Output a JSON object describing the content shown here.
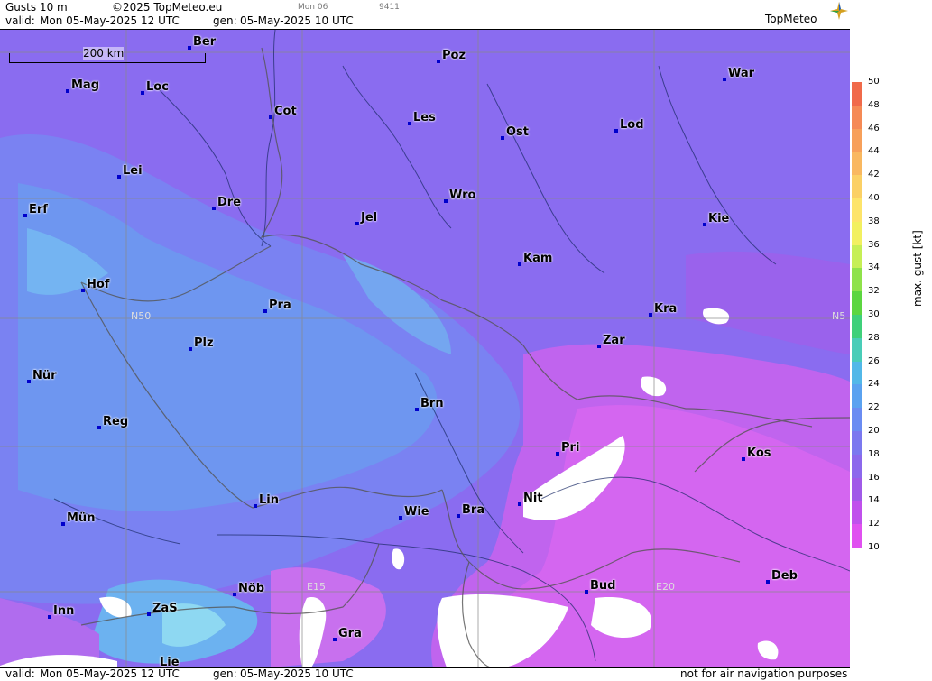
{
  "header": {
    "title": "Gusts 10 m",
    "copyright": "©2025 TopMeteo.eu",
    "day_small": "Mon 06",
    "code_small": "9411",
    "valid_label": "valid:",
    "valid": "Mon  05-May-2025  12 UTC",
    "gen_label": "gen:",
    "gen": "05-May-2025 10 UTC",
    "logo": "TopMeteo"
  },
  "scale_bar": "200 km",
  "grid_labels": {
    "n50_left": "N50",
    "n50_right": "N5",
    "e15": "E15",
    "e20": "E20"
  },
  "cities": [
    {
      "name": "Ber"
    },
    {
      "name": "Poz"
    },
    {
      "name": "War"
    },
    {
      "name": "Mag"
    },
    {
      "name": "Loc"
    },
    {
      "name": "Cot"
    },
    {
      "name": "Les"
    },
    {
      "name": "Ost"
    },
    {
      "name": "Lod"
    },
    {
      "name": "Lei"
    },
    {
      "name": "Erf"
    },
    {
      "name": "Dre"
    },
    {
      "name": "Wro"
    },
    {
      "name": "Jel"
    },
    {
      "name": "Kie"
    },
    {
      "name": "Kam"
    },
    {
      "name": "Hof"
    },
    {
      "name": "Pra"
    },
    {
      "name": "Kra"
    },
    {
      "name": "Plz"
    },
    {
      "name": "Zar"
    },
    {
      "name": "Nür"
    },
    {
      "name": "Brn"
    },
    {
      "name": "Reg"
    },
    {
      "name": "Pri"
    },
    {
      "name": "Kos"
    },
    {
      "name": "Nit"
    },
    {
      "name": "Lin"
    },
    {
      "name": "Wie"
    },
    {
      "name": "Bra"
    },
    {
      "name": "Mün"
    },
    {
      "name": "Deb"
    },
    {
      "name": "Nöb"
    },
    {
      "name": "Bud"
    },
    {
      "name": "Inn"
    },
    {
      "name": "ZaS"
    },
    {
      "name": "Gra"
    },
    {
      "name": "Lie"
    }
  ],
  "legend": {
    "title": "max. gust [kt]",
    "ticks": [
      "50",
      "48",
      "46",
      "44",
      "42",
      "40",
      "38",
      "36",
      "34",
      "32",
      "30",
      "28",
      "26",
      "24",
      "22",
      "20",
      "18",
      "16",
      "14",
      "12",
      "10"
    ],
    "colors": [
      "#f06a4a",
      "#f58a55",
      "#f7a05a",
      "#f9b860",
      "#fbd065",
      "#fde46a",
      "#f2f060",
      "#c6ef55",
      "#8fe24a",
      "#5cd640",
      "#3fd07a",
      "#49cdb8",
      "#52b8e8",
      "#5aa2f0",
      "#6a8cf2",
      "#7b78ef",
      "#8c68ec",
      "#a05ae8",
      "#c050ec",
      "#e050f0"
    ]
  },
  "footer": {
    "valid_label": "valid:",
    "valid": "Mon  05-May-2025  12 UTC",
    "gen_label": "gen:",
    "gen": "05-May-2025 10 UTC",
    "note": "not for air navigation purposes"
  }
}
